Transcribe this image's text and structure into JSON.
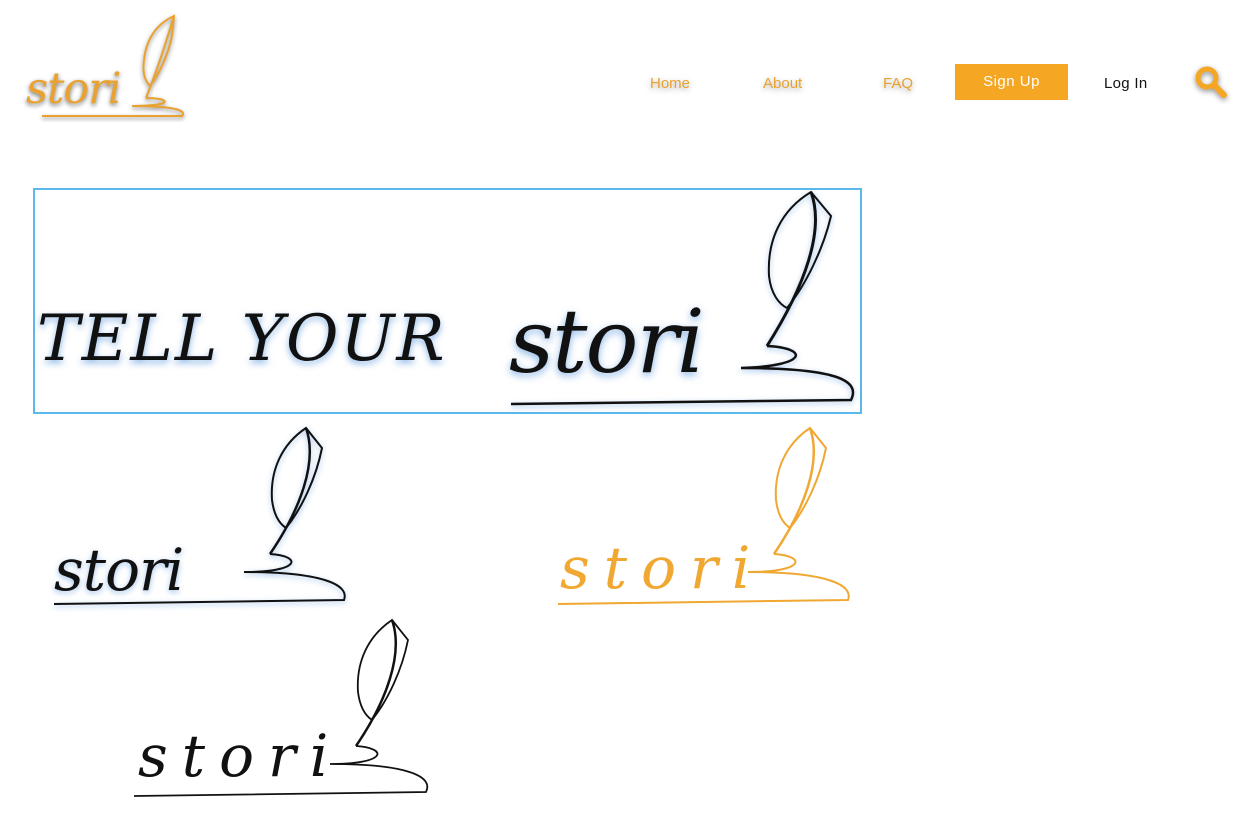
{
  "header": {
    "logo": {
      "text": "stori"
    },
    "nav": {
      "home": "Home",
      "about": "About",
      "faq": "FAQ",
      "signup": "Sign Up",
      "login": "Log In"
    },
    "search_icon": "search-icon"
  },
  "hero": {
    "tagline": "TELL YOUR",
    "brand": "stori"
  },
  "variants": [
    {
      "text": "stori"
    },
    {
      "text": "stori"
    },
    {
      "text": "stori"
    }
  ],
  "colors": {
    "accent": "#f5a623",
    "accent_text": "#e9a230",
    "selection_border": "#5bb8ea",
    "dark": "#111111"
  }
}
